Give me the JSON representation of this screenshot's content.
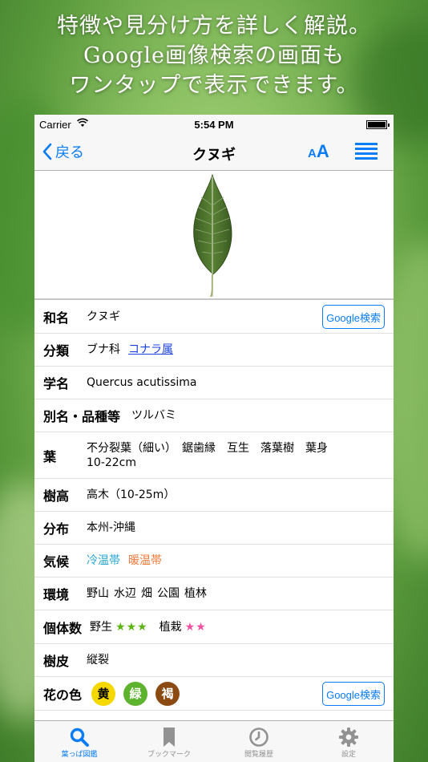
{
  "promo": {
    "line1": "特徴や見分け方を詳しく解説。",
    "line2": "Google画像検索の画面も",
    "line3": "ワンタップで表示できます。"
  },
  "status": {
    "carrier": "Carrier",
    "time": "5:54 PM"
  },
  "nav": {
    "back_label": "戻る",
    "title": "クヌギ",
    "font_small": "A",
    "font_big": "A"
  },
  "rows": {
    "wamei": {
      "label": "和名",
      "value": "クヌギ",
      "button": "Google検索"
    },
    "bunrui": {
      "label": "分類",
      "family": "ブナ科",
      "genus_link": "コナラ属"
    },
    "gakumei": {
      "label": "学名",
      "value": "Quercus acutissima"
    },
    "betsumei": {
      "label": "別名・品種等",
      "value": "ツルバミ"
    },
    "ha": {
      "label": "葉",
      "line1": "不分裂葉（細い）　鋸歯縁　互生　落葉樹　葉身",
      "line2": "10-22cm"
    },
    "jukou": {
      "label": "樹高",
      "value": "高木（10-25m）"
    },
    "bunpu": {
      "label": "分布",
      "value": "本州-沖縄"
    },
    "kikou": {
      "label": "気候",
      "cool": "冷温帯",
      "warm": "暖温帯"
    },
    "kankyou": {
      "label": "環境",
      "items": [
        "野山",
        "水辺",
        "畑",
        "公園",
        "植林"
      ]
    },
    "kotaisu": {
      "label": "個体数",
      "wild_label": "野生",
      "wild_stars": "★★★",
      "planted_label": "植栽",
      "planted_stars": "★★"
    },
    "juhi": {
      "label": "樹皮",
      "value": "縦裂"
    },
    "hana": {
      "label": "花の色",
      "button": "Google検索",
      "colors": [
        {
          "char": "黄",
          "bg": "#f5d800",
          "fg": "#000000"
        },
        {
          "char": "緑",
          "bg": "#5db22e",
          "fg": "#ffffff"
        },
        {
          "char": "褐",
          "bg": "#8a4a12",
          "fg": "#ffffff"
        }
      ]
    }
  },
  "tabs": [
    {
      "label": "葉っぱ図鑑",
      "icon": "search-icon",
      "active": true
    },
    {
      "label": "ブックマーク",
      "icon": "bookmark-icon",
      "active": false
    },
    {
      "label": "閲覧履歴",
      "icon": "history-icon",
      "active": false
    },
    {
      "label": "設定",
      "icon": "gear-icon",
      "active": false
    }
  ],
  "colors": {
    "accent": "#0a7cf5",
    "link": "#1a3fe0",
    "cool": "#29a8d6",
    "warm": "#f07a3a",
    "stars_wild": "#5cb314",
    "stars_planted": "#f050a0"
  }
}
